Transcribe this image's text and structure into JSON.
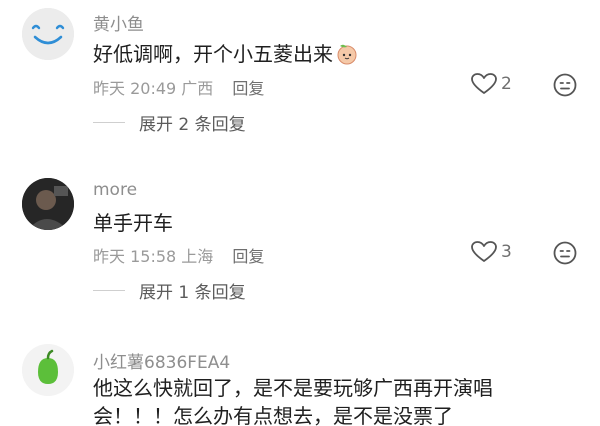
{
  "comments": [
    {
      "username": "黄小鱼",
      "text": "好低调啊，开个小五菱出来",
      "emoji": "peach-emoji",
      "date": "昨天 20:49",
      "location": "广西",
      "reply_label": "回复",
      "likes": "2",
      "expand_label": "展开 2 条回复"
    },
    {
      "username": "more",
      "text": "单手开车",
      "date": "昨天 15:58",
      "location": "上海",
      "reply_label": "回复",
      "likes": "3",
      "expand_label": "展开 1 条回复"
    },
    {
      "username": "小红薯6836FEA4",
      "text_line1": "他这么快就回了，是不是要玩够广西再开演唱",
      "text_line2": "会！！！怎么办有点想去，是不是没票了"
    }
  ]
}
